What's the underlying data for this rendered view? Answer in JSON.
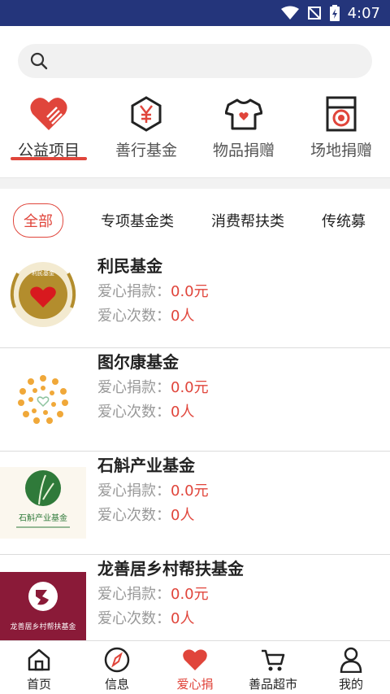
{
  "status": {
    "time": "4:07"
  },
  "search": {
    "placeholder": ""
  },
  "categories": [
    {
      "label": "公益项目",
      "icon": "heart-icon"
    },
    {
      "label": "善行基金",
      "icon": "yen-hexagon-icon"
    },
    {
      "label": "物品捐赠",
      "icon": "shirt-icon"
    },
    {
      "label": "场地捐赠",
      "icon": "venue-icon"
    }
  ],
  "subtabs": [
    "全部",
    "专项基金类",
    "消费帮扶类",
    "传统募"
  ],
  "funds": [
    {
      "name": "利民基金",
      "donation_label": "爱心捐款：",
      "donation": "0.0元",
      "count_label": "爱心次数：",
      "count": "0人"
    },
    {
      "name": "图尔康基金",
      "donation_label": "爱心捐款：",
      "donation": "0.0元",
      "count_label": "爱心次数：",
      "count": "0人"
    },
    {
      "name": "石斛产业基金",
      "donation_label": "爱心捐款：",
      "donation": "0.0元",
      "count_label": "爱心次数：",
      "count": "0人"
    },
    {
      "name": "龙善居乡村帮扶基金",
      "donation_label": "爱心捐款：",
      "donation": "0.0元",
      "count_label": "爱心次数：",
      "count": "0人"
    }
  ],
  "logos": {
    "limin_top": "利民基金",
    "shihu": "石斛产业基金",
    "longshanju": "龙善居乡村帮扶基金"
  },
  "bottom_nav": [
    {
      "label": "首页",
      "icon": "home-icon"
    },
    {
      "label": "信息",
      "icon": "compass-icon"
    },
    {
      "label": "爱心捐",
      "icon": "heart-icon"
    },
    {
      "label": "善品超市",
      "icon": "cart-icon"
    },
    {
      "label": "我的",
      "icon": "user-icon"
    }
  ],
  "colors": {
    "accent": "#e0453b",
    "statusbar": "#24357b"
  }
}
